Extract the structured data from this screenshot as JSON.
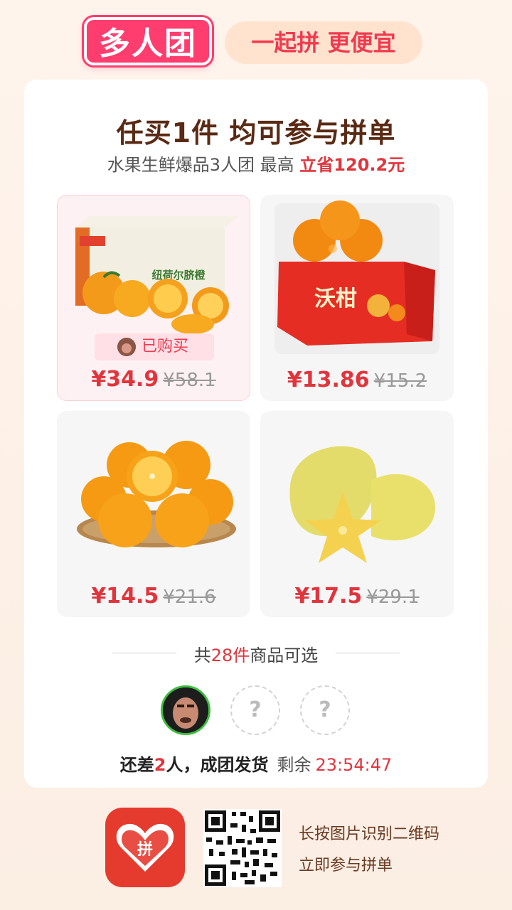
{
  "header": {
    "logo_text": "多人团",
    "slogan": "一起拼 更便宜"
  },
  "card": {
    "title": "任买1件 均可参与拼单",
    "subtitle_prefix": "水果生鲜爆品3人团 最高 ",
    "subtitle_highlight": "立省120.2元",
    "products": [
      {
        "name": "纽荷尔脐橙",
        "price": "¥34.9",
        "old_price": "¥58.1",
        "status": "已购买"
      },
      {
        "name": "沃柑",
        "price": "¥13.86",
        "old_price": "¥15.2"
      },
      {
        "name": "橙子",
        "price": "¥14.5",
        "old_price": "¥21.6"
      },
      {
        "name": "杨桃",
        "price": "¥17.5",
        "old_price": "¥29.1"
      }
    ],
    "count_prefix": "共",
    "count_number": "28件",
    "count_suffix": "商品可选",
    "empty_slot": "?",
    "status_prefix": "还差",
    "status_number": "2",
    "status_suffix": "人，成团发货",
    "remaining_label": "剩余",
    "countdown": "23:54:47"
  },
  "footer": {
    "app_icon_text": "拼",
    "line1": "长按图片识别二维码",
    "line2": "立即参与拼单"
  },
  "colors": {
    "accent": "#e0353d",
    "brand": "#ff3d6e",
    "background": "#fff4ec"
  }
}
